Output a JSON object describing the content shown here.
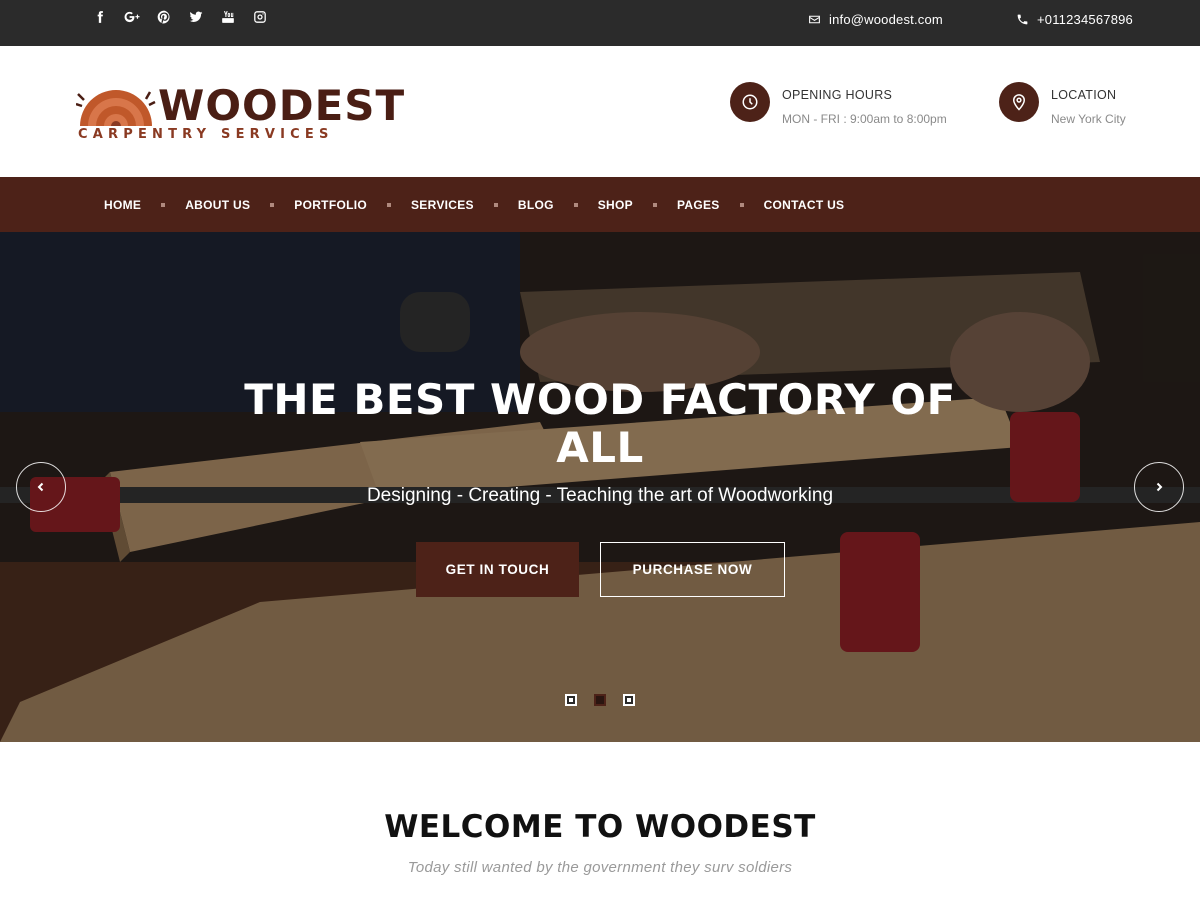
{
  "topbar": {
    "social_icons": [
      "facebook-icon",
      "google-plus-icon",
      "pinterest-icon",
      "twitter-icon",
      "youtube-icon",
      "instagram-icon"
    ],
    "email": "info@woodest.com",
    "phone": "+011234567896"
  },
  "logo": {
    "name": "WOODEST",
    "tagline": "CARPENTRY SERVICES"
  },
  "header": {
    "hours_title": "OPENING HOURS",
    "hours_value": "MON - FRI : 9:00am to 8:00pm",
    "location_title": "LOCATION",
    "location_value": "New York City"
  },
  "nav": {
    "items": [
      {
        "label": "HOME"
      },
      {
        "label": "ABOUT US"
      },
      {
        "label": "PORTFOLIO"
      },
      {
        "label": "SERVICES"
      },
      {
        "label": "BLOG"
      },
      {
        "label": "SHOP"
      },
      {
        "label": "PAGES"
      },
      {
        "label": "CONTACT US"
      }
    ]
  },
  "hero": {
    "title": "THE BEST WOOD FACTORY OF ALL",
    "subtitle": "Designing - Creating - Teaching the art of Woodworking",
    "btn_primary": "GET IN TOUCH",
    "btn_secondary": "PURCHASE NOW",
    "slides_total": 3,
    "active_slide": 2
  },
  "welcome": {
    "title": "WELCOME TO WOODEST",
    "subtitle": "Today still wanted by the government they surv soldiers"
  },
  "colors": {
    "brand_brown": "#4d2218",
    "topbar_bg": "#2b2b2b",
    "logo_accent": "#c0582a"
  }
}
